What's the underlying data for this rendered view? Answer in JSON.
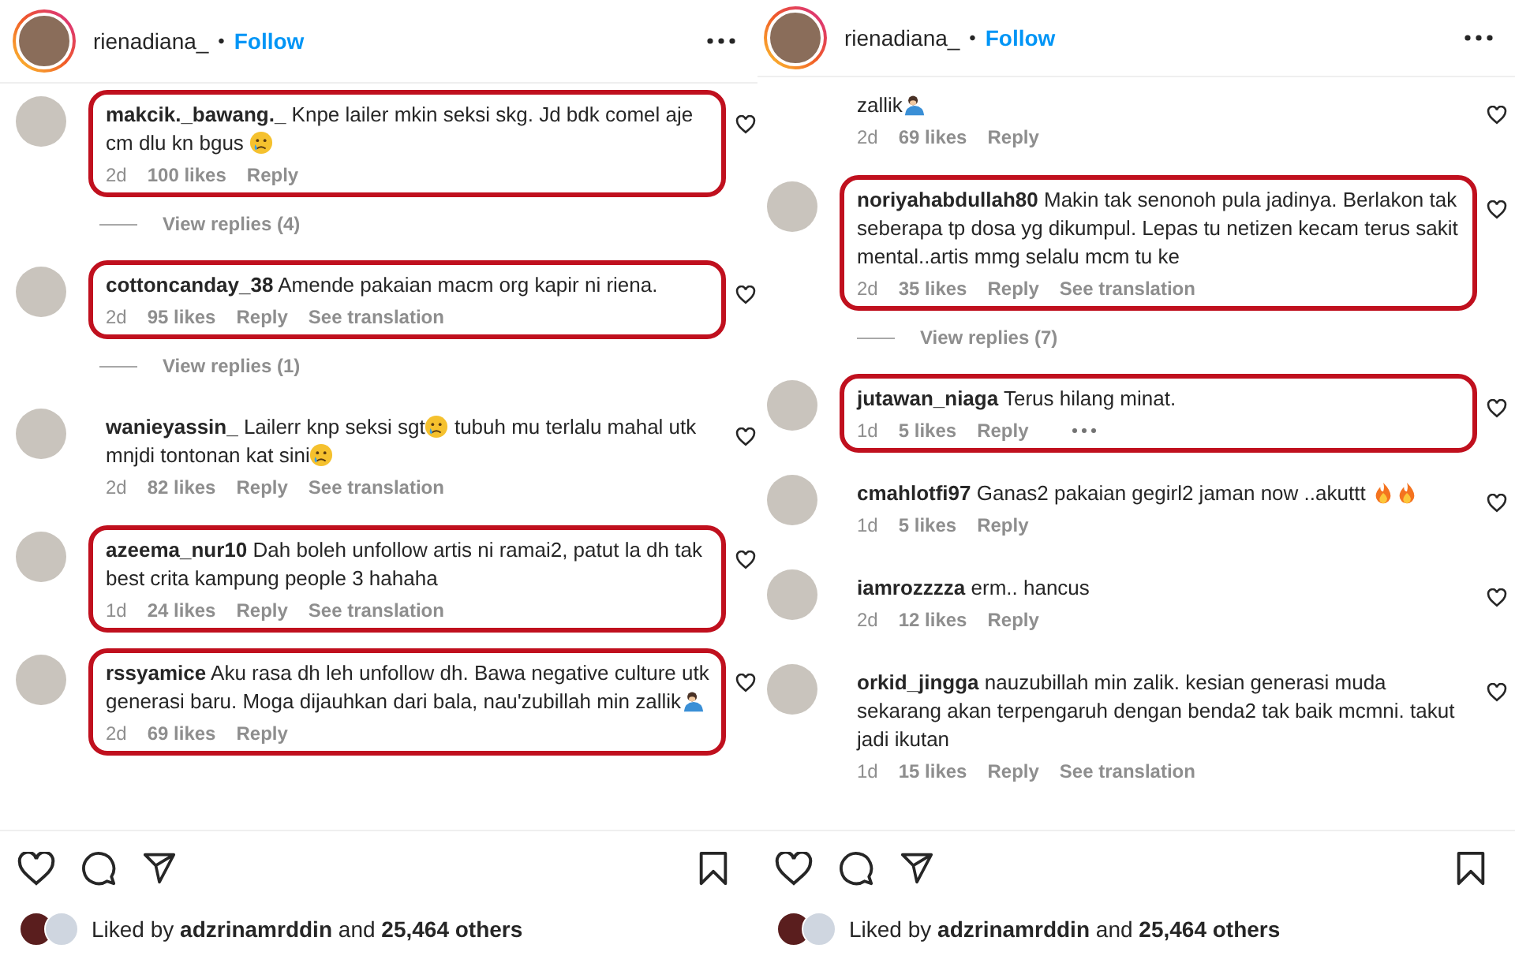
{
  "panels": [
    {
      "header": {
        "username": "rienadiana_",
        "separator": "•",
        "follow": "Follow"
      },
      "comments": [
        {
          "user": "makcik._bawang._",
          "parts": [
            {
              "kind": "text",
              "text": "Knpe lailer mkin seksi skg. Jd bdk comel aje cm dlu kn bgus "
            },
            {
              "kind": "tear"
            }
          ],
          "time": "2d",
          "likes": "100 likes",
          "reply": "Reply",
          "highlighted": true,
          "replies": "View replies (4)"
        },
        {
          "user": "cottoncanday_38",
          "parts": [
            {
              "kind": "text",
              "text": "Amende pakaian macm org kapir ni riena."
            }
          ],
          "time": "2d",
          "likes": "95 likes",
          "reply": "Reply",
          "translate": "See translation",
          "highlighted": true,
          "replies": "View replies (1)"
        },
        {
          "user": "wanieyassin_",
          "parts": [
            {
              "kind": "text",
              "text": "Lailerr knp seksi sgt"
            },
            {
              "kind": "tear"
            },
            {
              "kind": "text",
              "text": " tubuh mu terlalu mahal utk mnjdi tontonan kat sini"
            },
            {
              "kind": "tear"
            }
          ],
          "time": "2d",
          "likes": "82 likes",
          "reply": "Reply",
          "translate": "See translation",
          "highlighted": false
        },
        {
          "user": "azeema_nur10",
          "parts": [
            {
              "kind": "text",
              "text": "Dah boleh unfollow artis ni ramai2, patut la dh tak best crita kampung people 3 hahaha"
            }
          ],
          "time": "1d",
          "likes": "24 likes",
          "reply": "Reply",
          "translate": "See translation",
          "highlighted": true
        },
        {
          "user": "rssyamice",
          "parts": [
            {
              "kind": "text",
              "text": "Aku rasa dh leh unfollow dh. Bawa negative culture utk generasi baru. Moga dijauhkan dari bala, nau'zubillah min zallik"
            },
            {
              "kind": "bow"
            }
          ],
          "time": "2d",
          "likes": "69 likes",
          "reply": "Reply",
          "highlighted": true
        }
      ],
      "liked": "Liked by **adzrinamrddin** and **25,464 others**"
    },
    {
      "header": {
        "username": "rienadiana_",
        "separator": "•",
        "follow": "Follow"
      },
      "comments": [
        {
          "parts": [
            {
              "kind": "text",
              "text": "zallik"
            },
            {
              "kind": "bow"
            }
          ],
          "time": "2d",
          "likes": "69 likes",
          "reply": "Reply",
          "highlighted": false
        },
        {
          "user": "noriyahabdullah80",
          "parts": [
            {
              "kind": "text",
              "text": "Makin tak senonoh pula jadinya. Berlakon tak seberapa tp dosa yg dikumpul. Lepas tu netizen kecam terus sakit mental..artis mmg selalu mcm tu ke"
            }
          ],
          "time": "2d",
          "likes": "35 likes",
          "reply": "Reply",
          "translate": "See translation",
          "highlighted": true,
          "replies": "View replies (7)"
        },
        {
          "user": "jutawan_niaga",
          "parts": [
            {
              "kind": "text",
              "text": "Terus hilang minat."
            }
          ],
          "time": "1d",
          "likes": "5 likes",
          "reply": "Reply",
          "more": true,
          "highlighted": true
        },
        {
          "user": "cmahlotfi97",
          "parts": [
            {
              "kind": "text",
              "text": "Ganas2 pakaian gegirl2 jaman now ..akuttt "
            },
            {
              "kind": "fire"
            },
            {
              "kind": "fire"
            }
          ],
          "time": "1d",
          "likes": "5 likes",
          "reply": "Reply",
          "highlighted": false
        },
        {
          "user": "iamrozzzza",
          "parts": [
            {
              "kind": "text",
              "text": "erm.. hancus"
            }
          ],
          "time": "2d",
          "likes": "12 likes",
          "reply": "Reply",
          "highlighted": false
        },
        {
          "user": "orkid_jingga",
          "parts": [
            {
              "kind": "text",
              "text": "nauzubillah min zalik. kesian generasi muda sekarang akan terpengaruh dengan benda2 tak baik mcmni. takut jadi ikutan"
            }
          ],
          "time": "1d",
          "likes": "15 likes",
          "reply": "Reply",
          "translate": "See translation",
          "highlighted": false
        }
      ],
      "liked": "Liked by **adzrinamrddin** and **25,464 others**"
    }
  ]
}
